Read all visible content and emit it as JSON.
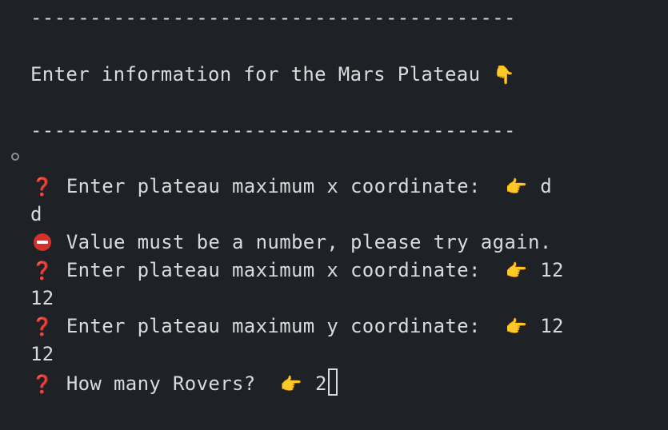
{
  "terminal": {
    "separator_top": "-----------------------------------------",
    "heading": "Enter information for the Mars Plateau",
    "separator_bottom": "-----------------------------------------",
    "lines": [
      {
        "prompt": "Enter plateau maximum x coordinate:",
        "answer": "d"
      },
      {
        "echo": "d"
      },
      {
        "error": "Value must be a number, please try again."
      },
      {
        "prompt": "Enter plateau maximum x coordinate:",
        "answer": "12"
      },
      {
        "echo": "12"
      },
      {
        "prompt": "Enter plateau maximum y coordinate:",
        "answer": "12"
      },
      {
        "echo": "12"
      },
      {
        "prompt": "How many Rovers?",
        "answer": "2"
      }
    ]
  },
  "icons": {
    "heading_icon": "backhand-index-pointing-down-icon",
    "prompt_icon": "red-question-mark-icon",
    "answer_icon": "backhand-index-pointing-right-icon",
    "error_icon": "no-entry-icon"
  },
  "colors": {
    "background": "#1e2226",
    "text": "#d8dadc",
    "question": "#e0342c",
    "error": "#d3322a",
    "hand": "#f3c34a"
  }
}
